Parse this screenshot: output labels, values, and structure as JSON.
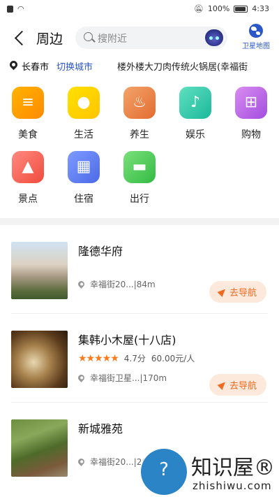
{
  "status_bar": {
    "battery": "100%",
    "time": "4:33"
  },
  "header": {
    "title": "周边",
    "search_placeholder": "搜附近",
    "satellite_label": "卫星地图"
  },
  "location": {
    "city": "长春市",
    "switch_label": "切换城市",
    "address": "楼外楼大刀肉传统火锅居(幸福街"
  },
  "categories": [
    {
      "label": "美食",
      "icon": "burger-icon"
    },
    {
      "label": "生活",
      "icon": "lightbulb-icon"
    },
    {
      "label": "养生",
      "icon": "massage-icon"
    },
    {
      "label": "娱乐",
      "icon": "guitar-icon"
    },
    {
      "label": "购物",
      "icon": "cart-icon"
    },
    {
      "label": "景点",
      "icon": "palm-island-icon"
    },
    {
      "label": "住宿",
      "icon": "building-icon"
    },
    {
      "label": "出行",
      "icon": "car-icon"
    }
  ],
  "places": [
    {
      "name": "隆德华府",
      "address": "幸福街20...",
      "distance": "|84m",
      "nav_label": "去导航"
    },
    {
      "name": "集韩小木屋(十八店)",
      "rating": "4.7分",
      "price": "60.00元/人",
      "stars": "★★★★★",
      "address": "幸福街卫星...",
      "distance": "|170m",
      "nav_label": "去导航"
    },
    {
      "name": "新城雅苑",
      "address": "幸福街20...",
      "distance": "|28"
    }
  ],
  "watermark": {
    "title": "知识屋®",
    "subtitle": "zhishiwu.com"
  }
}
